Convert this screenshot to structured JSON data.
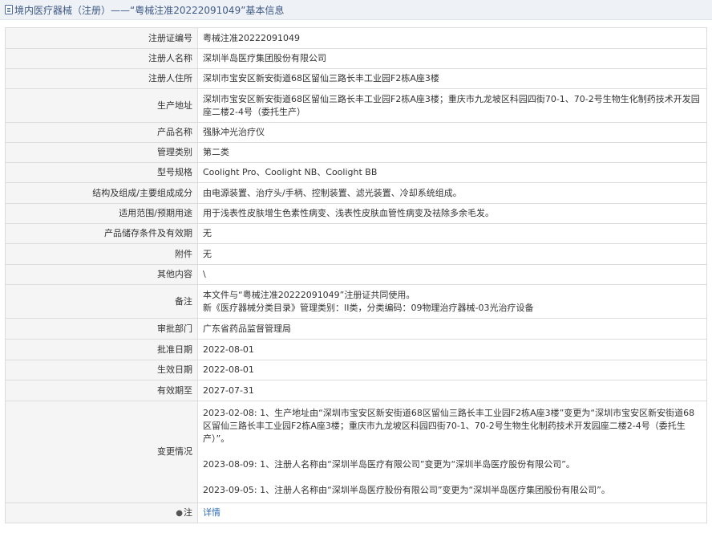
{
  "header": {
    "title": "境内医疗器械（注册）——“粤械注准20222091049”基本信息"
  },
  "rows": {
    "reg_no": {
      "label": "注册证编号",
      "value": "粤械注准20222091049"
    },
    "registrant": {
      "label": "注册人名称",
      "value": "深圳半岛医疗集团股份有限公司"
    },
    "registrant_addr": {
      "label": "注册人住所",
      "value": "深圳市宝安区新安街道68区留仙三路长丰工业园F2栋A座3楼"
    },
    "production_addr": {
      "label": "生产地址",
      "value": "深圳市宝安区新安街道68区留仙三路长丰工业园F2栋A座3楼；重庆市九龙坡区科园四街70-1、70-2号生物生化制药技术开发园座二楼2-4号（委托生产）"
    },
    "product_name": {
      "label": "产品名称",
      "value": "强脉冲光治疗仪"
    },
    "category": {
      "label": "管理类别",
      "value": "第二类"
    },
    "model": {
      "label": "型号规格",
      "value": "Coolight Pro、Coolight NB、Coolight BB"
    },
    "structure": {
      "label": "结构及组成/主要组成成分",
      "value": "由电源装置、治疗头/手柄、控制装置、滤光装置、冷却系统组成。"
    },
    "scope": {
      "label": "适用范围/预期用途",
      "value": "用于浅表性皮肤增生色素性病变、浅表性皮肤血管性病变及祛除多余毛发。"
    },
    "storage": {
      "label": "产品储存条件及有效期",
      "value": "无"
    },
    "attachment": {
      "label": "附件",
      "value": "无"
    },
    "other": {
      "label": "其他内容",
      "value": "\\"
    },
    "remark": {
      "label": "备注",
      "line1": "本文件与“粤械注准20222091049”注册证共同使用。",
      "line2": "新《医疗器械分类目录》管理类别：II类，分类编码：09物理治疗器械-03光治疗设备"
    },
    "approval_dept": {
      "label": "审批部门",
      "value": "广东省药品监督管理局"
    },
    "approval_date": {
      "label": "批准日期",
      "value": "2022-08-01"
    },
    "effective_date": {
      "label": "生效日期",
      "value": "2022-08-01"
    },
    "expiry_date": {
      "label": "有效期至",
      "value": "2027-07-31"
    },
    "changes": {
      "label": "变更情况",
      "entry1": "2023-02-08: 1、生产地址由“深圳市宝安区新安街道68区留仙三路长丰工业园F2栋A座3楼”变更为“深圳市宝安区新安街道68区留仙三路长丰工业园F2栋A座3楼；重庆市九龙坡区科园四街70-1、70-2号生物生化制药技术开发园座二楼2-4号（委托生产）”。",
      "entry2": "2023-08-09: 1、注册人名称由“深圳半岛医疗有限公司”变更为“深圳半岛医疗股份有限公司”。",
      "entry3": "2023-09-05: 1、注册人名称由“深圳半岛医疗股份有限公司”变更为“深圳半岛医疗集团股份有限公司”。"
    },
    "note": {
      "label": "注",
      "link": "详情",
      "icon": "pin-icon"
    }
  }
}
